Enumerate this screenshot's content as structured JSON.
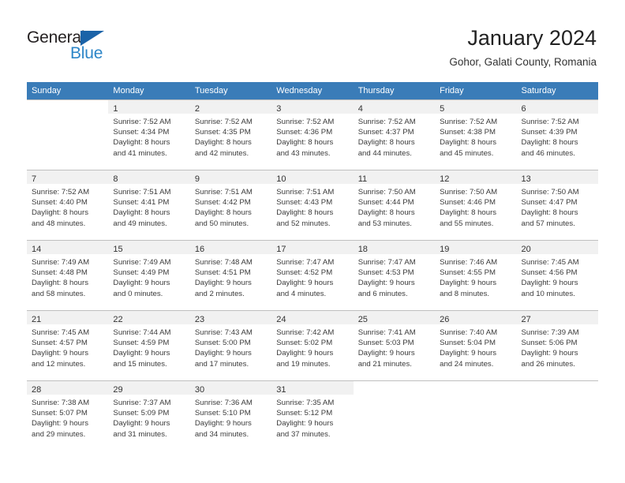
{
  "brand": {
    "name_top": "General",
    "name_bottom": "Blue",
    "triangle_icon": "triangle-icon",
    "color_dark": "#231f20",
    "color_blue": "#2d86c8"
  },
  "header": {
    "title": "January 2024",
    "subtitle": "Gohor, Galati County, Romania"
  },
  "theme": {
    "header_band": "#3a7cb8",
    "daynum_band": "#f1f1f1",
    "grid_line": "#bfbfbf",
    "text": "#3b3b3b"
  },
  "weekdays": [
    "Sunday",
    "Monday",
    "Tuesday",
    "Wednesday",
    "Thursday",
    "Friday",
    "Saturday"
  ],
  "weeks": [
    [
      {
        "day": "",
        "lines": []
      },
      {
        "day": "1",
        "lines": [
          "Sunrise: 7:52 AM",
          "Sunset: 4:34 PM",
          "Daylight: 8 hours",
          "and 41 minutes."
        ]
      },
      {
        "day": "2",
        "lines": [
          "Sunrise: 7:52 AM",
          "Sunset: 4:35 PM",
          "Daylight: 8 hours",
          "and 42 minutes."
        ]
      },
      {
        "day": "3",
        "lines": [
          "Sunrise: 7:52 AM",
          "Sunset: 4:36 PM",
          "Daylight: 8 hours",
          "and 43 minutes."
        ]
      },
      {
        "day": "4",
        "lines": [
          "Sunrise: 7:52 AM",
          "Sunset: 4:37 PM",
          "Daylight: 8 hours",
          "and 44 minutes."
        ]
      },
      {
        "day": "5",
        "lines": [
          "Sunrise: 7:52 AM",
          "Sunset: 4:38 PM",
          "Daylight: 8 hours",
          "and 45 minutes."
        ]
      },
      {
        "day": "6",
        "lines": [
          "Sunrise: 7:52 AM",
          "Sunset: 4:39 PM",
          "Daylight: 8 hours",
          "and 46 minutes."
        ]
      }
    ],
    [
      {
        "day": "7",
        "lines": [
          "Sunrise: 7:52 AM",
          "Sunset: 4:40 PM",
          "Daylight: 8 hours",
          "and 48 minutes."
        ]
      },
      {
        "day": "8",
        "lines": [
          "Sunrise: 7:51 AM",
          "Sunset: 4:41 PM",
          "Daylight: 8 hours",
          "and 49 minutes."
        ]
      },
      {
        "day": "9",
        "lines": [
          "Sunrise: 7:51 AM",
          "Sunset: 4:42 PM",
          "Daylight: 8 hours",
          "and 50 minutes."
        ]
      },
      {
        "day": "10",
        "lines": [
          "Sunrise: 7:51 AM",
          "Sunset: 4:43 PM",
          "Daylight: 8 hours",
          "and 52 minutes."
        ]
      },
      {
        "day": "11",
        "lines": [
          "Sunrise: 7:50 AM",
          "Sunset: 4:44 PM",
          "Daylight: 8 hours",
          "and 53 minutes."
        ]
      },
      {
        "day": "12",
        "lines": [
          "Sunrise: 7:50 AM",
          "Sunset: 4:46 PM",
          "Daylight: 8 hours",
          "and 55 minutes."
        ]
      },
      {
        "day": "13",
        "lines": [
          "Sunrise: 7:50 AM",
          "Sunset: 4:47 PM",
          "Daylight: 8 hours",
          "and 57 minutes."
        ]
      }
    ],
    [
      {
        "day": "14",
        "lines": [
          "Sunrise: 7:49 AM",
          "Sunset: 4:48 PM",
          "Daylight: 8 hours",
          "and 58 minutes."
        ]
      },
      {
        "day": "15",
        "lines": [
          "Sunrise: 7:49 AM",
          "Sunset: 4:49 PM",
          "Daylight: 9 hours",
          "and 0 minutes."
        ]
      },
      {
        "day": "16",
        "lines": [
          "Sunrise: 7:48 AM",
          "Sunset: 4:51 PM",
          "Daylight: 9 hours",
          "and 2 minutes."
        ]
      },
      {
        "day": "17",
        "lines": [
          "Sunrise: 7:47 AM",
          "Sunset: 4:52 PM",
          "Daylight: 9 hours",
          "and 4 minutes."
        ]
      },
      {
        "day": "18",
        "lines": [
          "Sunrise: 7:47 AM",
          "Sunset: 4:53 PM",
          "Daylight: 9 hours",
          "and 6 minutes."
        ]
      },
      {
        "day": "19",
        "lines": [
          "Sunrise: 7:46 AM",
          "Sunset: 4:55 PM",
          "Daylight: 9 hours",
          "and 8 minutes."
        ]
      },
      {
        "day": "20",
        "lines": [
          "Sunrise: 7:45 AM",
          "Sunset: 4:56 PM",
          "Daylight: 9 hours",
          "and 10 minutes."
        ]
      }
    ],
    [
      {
        "day": "21",
        "lines": [
          "Sunrise: 7:45 AM",
          "Sunset: 4:57 PM",
          "Daylight: 9 hours",
          "and 12 minutes."
        ]
      },
      {
        "day": "22",
        "lines": [
          "Sunrise: 7:44 AM",
          "Sunset: 4:59 PM",
          "Daylight: 9 hours",
          "and 15 minutes."
        ]
      },
      {
        "day": "23",
        "lines": [
          "Sunrise: 7:43 AM",
          "Sunset: 5:00 PM",
          "Daylight: 9 hours",
          "and 17 minutes."
        ]
      },
      {
        "day": "24",
        "lines": [
          "Sunrise: 7:42 AM",
          "Sunset: 5:02 PM",
          "Daylight: 9 hours",
          "and 19 minutes."
        ]
      },
      {
        "day": "25",
        "lines": [
          "Sunrise: 7:41 AM",
          "Sunset: 5:03 PM",
          "Daylight: 9 hours",
          "and 21 minutes."
        ]
      },
      {
        "day": "26",
        "lines": [
          "Sunrise: 7:40 AM",
          "Sunset: 5:04 PM",
          "Daylight: 9 hours",
          "and 24 minutes."
        ]
      },
      {
        "day": "27",
        "lines": [
          "Sunrise: 7:39 AM",
          "Sunset: 5:06 PM",
          "Daylight: 9 hours",
          "and 26 minutes."
        ]
      }
    ],
    [
      {
        "day": "28",
        "lines": [
          "Sunrise: 7:38 AM",
          "Sunset: 5:07 PM",
          "Daylight: 9 hours",
          "and 29 minutes."
        ]
      },
      {
        "day": "29",
        "lines": [
          "Sunrise: 7:37 AM",
          "Sunset: 5:09 PM",
          "Daylight: 9 hours",
          "and 31 minutes."
        ]
      },
      {
        "day": "30",
        "lines": [
          "Sunrise: 7:36 AM",
          "Sunset: 5:10 PM",
          "Daylight: 9 hours",
          "and 34 minutes."
        ]
      },
      {
        "day": "31",
        "lines": [
          "Sunrise: 7:35 AM",
          "Sunset: 5:12 PM",
          "Daylight: 9 hours",
          "and 37 minutes."
        ]
      },
      {
        "day": "",
        "lines": []
      },
      {
        "day": "",
        "lines": []
      },
      {
        "day": "",
        "lines": []
      }
    ]
  ]
}
